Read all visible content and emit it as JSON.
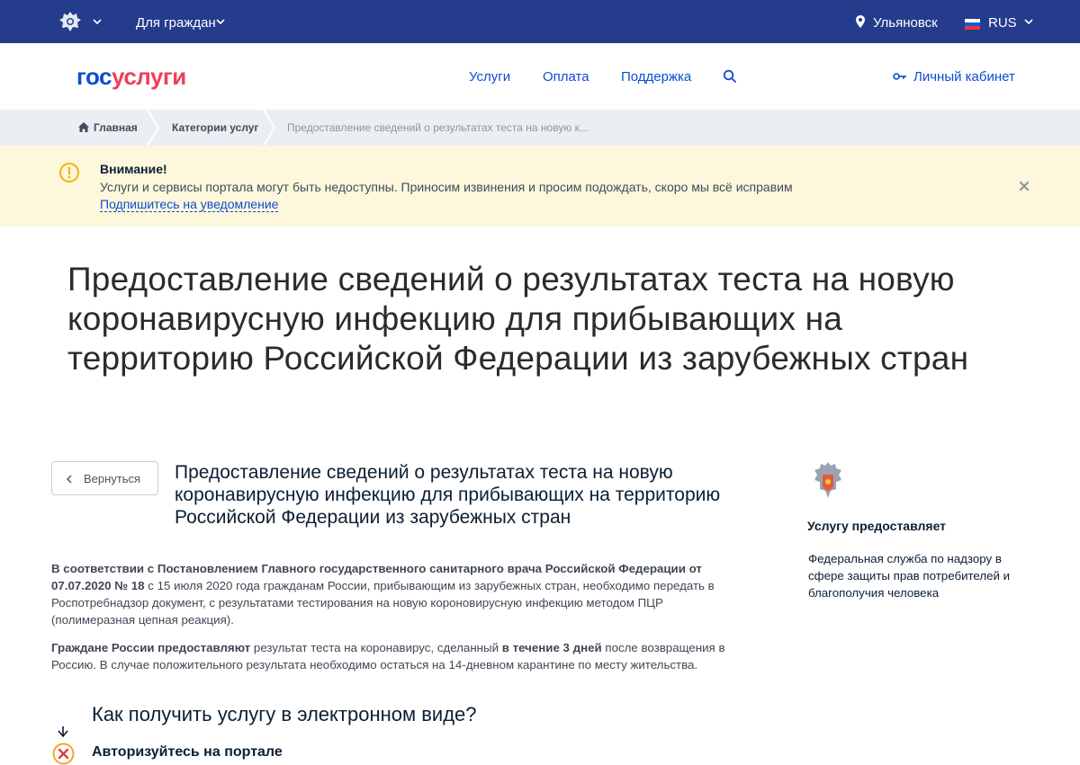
{
  "topbar": {
    "for_citizens": "Для граждан",
    "city": "Ульяновск",
    "lang": "RUS",
    "bg_color": "#253b8c"
  },
  "header": {
    "logo_part1": "гос",
    "logo_part2": "услуги",
    "nav": [
      "Услуги",
      "Оплата",
      "Поддержка"
    ],
    "cabinet": "Личный кабинет"
  },
  "breadcrumbs": [
    "Главная",
    "Категории услуг",
    "Предоставление сведений о результатах теста на новую к..."
  ],
  "alert": {
    "title": "Внимание!",
    "text": "Услуги и сервисы портала могут быть недоступны. Приносим извинения и просим подождать, скоро мы всё исправим",
    "link": "Подпишитесь на уведомление"
  },
  "page": {
    "title": "Предоставление сведений о результатах теста на новую коронавирусную инфекцию для прибывающих на территорию Российской Федерации из зарубежных стран",
    "back_label": "Вернуться",
    "subtitle": "Предоставление сведений о результатах теста на новую коронавирусную инфекцию для прибывающих на территорию Российской Федерации из зарубежных стран",
    "p1_bold": "В соответствии с Постановлением Главного государственного санитарного врача Российской Федерации от 07.07.2020 № 18",
    "p1_rest": " с 15 июля 2020 года гражданам России, прибывающим из зарубежных стран, необходимо передать в Роспотребнадзор документ, с результатами тестирования на новую короновирусную инфекцию методом ПЦР (полимеразная цепная реакция).",
    "p2_bold1": "Граждане России предоставляют",
    "p2_mid": " результат теста на коронавирус, сделанный ",
    "p2_bold2": "в течение 3 дней",
    "p2_rest": " после возвращения в Россию. В случае положительного результата необходимо остаться на 14-дневном карантине по месту жительства.",
    "how_title": "Как получить услугу в электронном виде?",
    "step1": "Авторизуйтесь на портале"
  },
  "provider": {
    "label": "Услугу предоставляет",
    "name": "Федеральная служба по надзору в сфере защиты прав потребителей и благополучия человека"
  }
}
